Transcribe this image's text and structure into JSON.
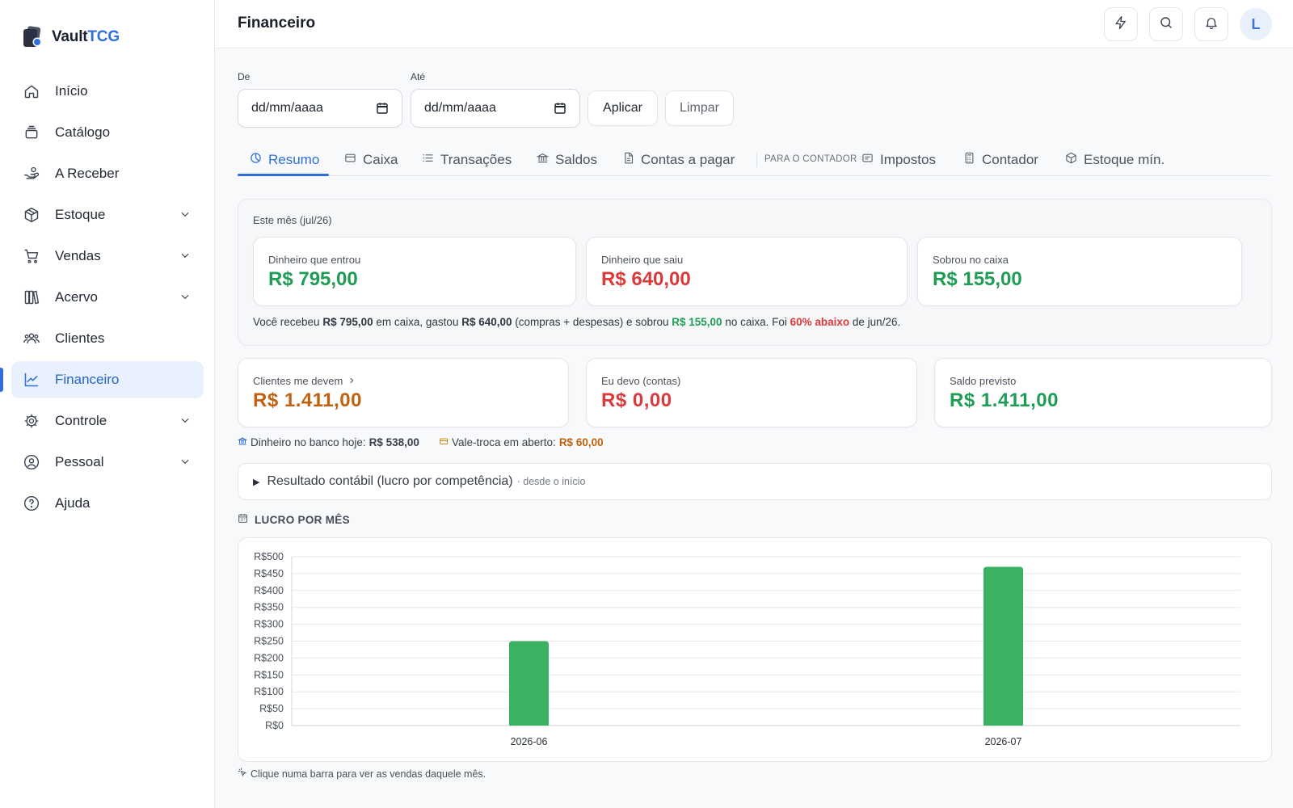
{
  "brand": {
    "name_main": "Vault",
    "name_accent": "TCG"
  },
  "sidebar": {
    "items": [
      {
        "label": "Início",
        "icon": "home-icon",
        "expandable": false
      },
      {
        "label": "Catálogo",
        "icon": "cards-icon",
        "expandable": false
      },
      {
        "label": "A Receber",
        "icon": "hand-coins-icon",
        "expandable": false
      },
      {
        "label": "Estoque",
        "icon": "box-icon",
        "expandable": true
      },
      {
        "label": "Vendas",
        "icon": "cart-icon",
        "expandable": true
      },
      {
        "label": "Acervo",
        "icon": "library-icon",
        "expandable": true
      },
      {
        "label": "Clientes",
        "icon": "users-icon",
        "expandable": false
      },
      {
        "label": "Financeiro",
        "icon": "trend-chart-icon",
        "expandable": false,
        "active": true
      },
      {
        "label": "Controle",
        "icon": "gear-icon",
        "expandable": true
      },
      {
        "label": "Pessoal",
        "icon": "user-circle-icon",
        "expandable": true
      },
      {
        "label": "Ajuda",
        "icon": "help-icon",
        "expandable": false
      }
    ]
  },
  "header": {
    "title": "Financeiro",
    "avatar_initial": "L",
    "buttons": [
      "lightning-icon",
      "search-icon",
      "bell-icon"
    ]
  },
  "filters": {
    "from_label": "De",
    "to_label": "Até",
    "from_placeholder": "dd/mm/aaaa",
    "to_placeholder": "dd/mm/aaaa",
    "apply_label": "Aplicar",
    "clear_label": "Limpar"
  },
  "tabs": {
    "resumo": "Resumo",
    "caixa": "Caixa",
    "transacoes": "Transações",
    "saldos": "Saldos",
    "contas": "Contas a pagar",
    "caption": "PARA O CONTADOR",
    "impostos": "Impostos",
    "contador": "Contador",
    "estoque": "Estoque mín.",
    "active": "Resumo"
  },
  "month": {
    "title": "Este mês (jul/26)",
    "in_label": "Dinheiro que entrou",
    "in_value": "R$ 795,00",
    "out_label": "Dinheiro que saiu",
    "out_value": "R$ 640,00",
    "left_label": "Sobrou no caixa",
    "left_value": "R$ 155,00",
    "summary": {
      "p1": "Você recebeu ",
      "v1": "R$ 795,00",
      "p2": " em caixa, gastou ",
      "v2": "R$ 640,00",
      "p3": " (compras + despesas) e sobrou ",
      "v3": "R$ 155,00",
      "p4": " no caixa. Foi ",
      "v4": "60% abaixo",
      "p5": " de jun/26."
    }
  },
  "balances": {
    "owed_to_me_label": "Clientes me devem",
    "owed_to_me_value": "R$ 1.411,00",
    "i_owe_label": "Eu devo (contas)",
    "i_owe_value": "R$ 0,00",
    "forecast_label": "Saldo previsto",
    "forecast_value": "R$ 1.411,00",
    "bank_label": "Dinheiro no banco hoje:",
    "bank_value": "R$ 538,00",
    "voucher_label": "Vale-troca em aberto:",
    "voucher_value": "R$ 60,00"
  },
  "accrual": {
    "title": "Resultado contábil (lucro por competência)",
    "subtitle": "· desde o início"
  },
  "profit_section": {
    "title": "LUCRO POR MÊS",
    "hint": "Clique numa barra para ver as vendas daquele mês."
  },
  "chart_data": {
    "type": "bar",
    "categories": [
      "2026-06",
      "2026-07"
    ],
    "values": [
      250,
      470
    ],
    "ylim": [
      0,
      500
    ],
    "yticks": [
      0,
      50,
      100,
      150,
      200,
      250,
      300,
      350,
      400,
      450,
      500
    ],
    "ytick_prefix": "R$",
    "bar_color": "#3bb162",
    "grid": true,
    "legend": "none"
  }
}
